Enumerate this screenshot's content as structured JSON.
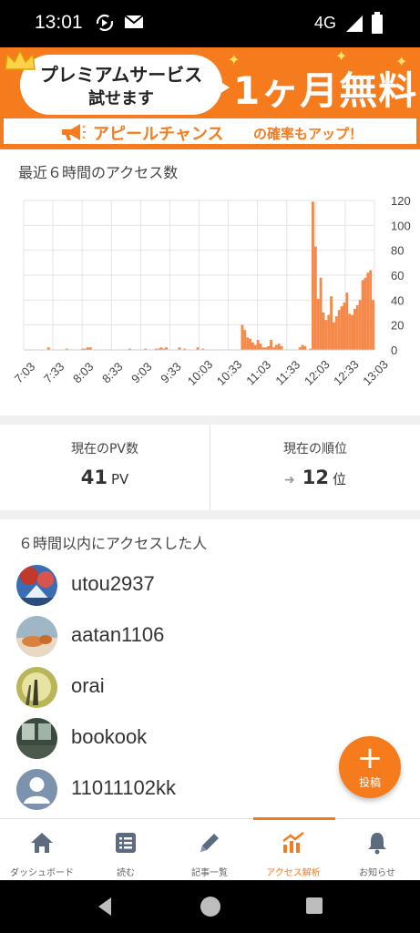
{
  "status": {
    "time": "13:01",
    "network": "4G"
  },
  "banner": {
    "line1": "プレミアムサービス",
    "line2": "試せます",
    "free": "1ヶ月無料",
    "strip_label": "アピールチャンス",
    "strip_rest": "の確率もアップ！"
  },
  "chart_title": "最近６時間のアクセス数",
  "chart_data": {
    "type": "bar",
    "title": "最近６時間のアクセス数",
    "ylim": [
      0,
      120
    ],
    "y_ticks": [
      "0",
      "20",
      "40",
      "60",
      "80",
      "100",
      "120"
    ],
    "x_ticks": [
      "7:03",
      "7:33",
      "8:03",
      "8:33",
      "9:03",
      "9:33",
      "10:03",
      "10:33",
      "11:03",
      "11:33",
      "12:03",
      "12:33",
      "13:03"
    ],
    "values": [
      0,
      0,
      0,
      0,
      0,
      0,
      0,
      0,
      0,
      2,
      0,
      0,
      0,
      0,
      0,
      0,
      1,
      0,
      0,
      0,
      0,
      0,
      1,
      1,
      2,
      2,
      0,
      0,
      0,
      0,
      0,
      0,
      0,
      0,
      0,
      0,
      0,
      0,
      0,
      0,
      1,
      0,
      0,
      0,
      0,
      0,
      1,
      0,
      0,
      0,
      1,
      1,
      2,
      1,
      2,
      0,
      0,
      0,
      0,
      2,
      0,
      1,
      0,
      0,
      0,
      0,
      2,
      0,
      1,
      0,
      0,
      0,
      0,
      0,
      0,
      0,
      0,
      0,
      0,
      0,
      0,
      0,
      0,
      20,
      16,
      10,
      9,
      6,
      4,
      8,
      5,
      2,
      2,
      3,
      8,
      2,
      4,
      5,
      3,
      0,
      0,
      0,
      0,
      0,
      0,
      2,
      4,
      3,
      0,
      1,
      119,
      83,
      41,
      58,
      30,
      24,
      28,
      43,
      22,
      27,
      32,
      35,
      38,
      46,
      29,
      28,
      33,
      36,
      40,
      56,
      58,
      62,
      64,
      40
    ],
    "grid": true,
    "color": "#f4894a"
  },
  "stats": {
    "pv_label": "現在のPV数",
    "pv_value": "41",
    "pv_unit": "PV",
    "rank_label": "現在の順位",
    "rank_arrow": "➜",
    "rank_value": "12",
    "rank_unit": "位"
  },
  "users_title": "６時間以内にアクセスした人",
  "users": [
    {
      "name": "utou2937"
    },
    {
      "name": "aatan1106"
    },
    {
      "name": "orai"
    },
    {
      "name": "bookook"
    },
    {
      "name": "11011102kk"
    }
  ],
  "fab_label": "投稿",
  "tabs": [
    {
      "label": "ダッシュボード",
      "icon": "home-icon"
    },
    {
      "label": "読む",
      "icon": "list-icon"
    },
    {
      "label": "記事一覧",
      "icon": "pencil-icon"
    },
    {
      "label": "アクセス解析",
      "icon": "analytics-icon"
    },
    {
      "label": "お知らせ",
      "icon": "bell-icon"
    }
  ],
  "colors": {
    "accent": "#f67b1c",
    "tab_inactive": "#5c6b80"
  }
}
